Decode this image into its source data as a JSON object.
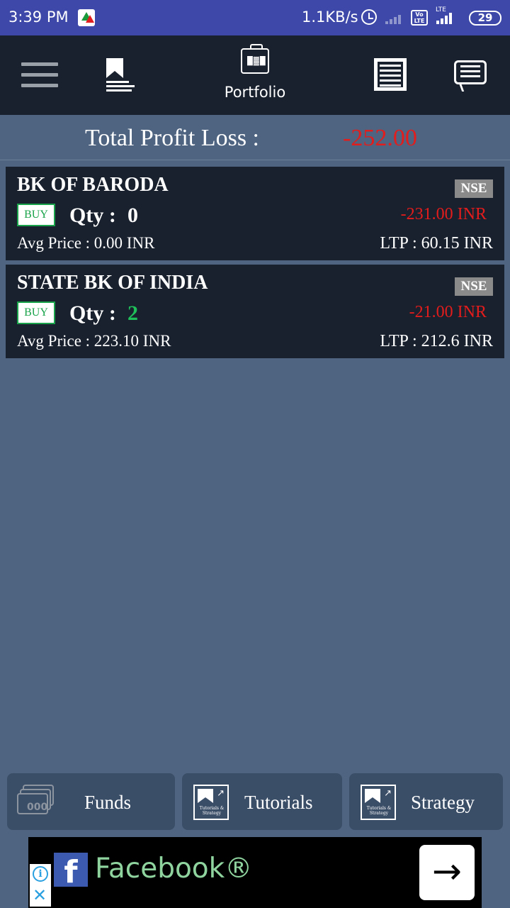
{
  "status_bar": {
    "time": "3:39 PM",
    "network_speed": "1.1KB/s",
    "volte_label": "Vo LTE",
    "lte_label": "LTE",
    "battery": "29",
    "icons": [
      "app-notification-icon",
      "alarm-icon",
      "signal-icon",
      "volte-icon",
      "battery-icon"
    ]
  },
  "nav": {
    "active_tab": "Portfolio",
    "icons": [
      "menu-icon",
      "watchlist-bookmark-icon",
      "portfolio-icon",
      "virtual-trading-news-icon",
      "chat-icon"
    ]
  },
  "summary": {
    "label": "Total Profit Loss :",
    "value": "-252.00",
    "value_color": "#e31c1c"
  },
  "positions": [
    {
      "name": "BK OF BARODA",
      "exchange": "NSE",
      "side": "BUY",
      "qty_label": "Qty :",
      "qty": "0",
      "qty_color": "#ffffff",
      "pl": "-231.00 INR",
      "avg_price": "Avg Price :  0.00 INR",
      "ltp": "LTP :  60.15 INR"
    },
    {
      "name": "STATE BK OF INDIA",
      "exchange": "NSE",
      "side": "BUY",
      "qty_label": "Qty :",
      "qty": "2",
      "qty_color": "#1fbf5a",
      "pl": "-21.00 INR",
      "avg_price": "Avg Price :  223.10 INR",
      "ltp": "LTP :  212.6 INR"
    }
  ],
  "bottom_buttons": {
    "funds": "Funds",
    "tutorials": "Tutorials",
    "strategy": "Strategy",
    "book_caption": "Tutorials & Strategy"
  },
  "ad": {
    "title": "Facebook®",
    "logo_letter": "f",
    "info_glyph": "i",
    "close_glyph": "✕",
    "cta_glyph": "→"
  },
  "colors": {
    "background": "#4f6480",
    "header": "#19212e",
    "status_bar": "#3d48a8",
    "loss": "#e31c1c",
    "buy": "#1aa34a"
  }
}
